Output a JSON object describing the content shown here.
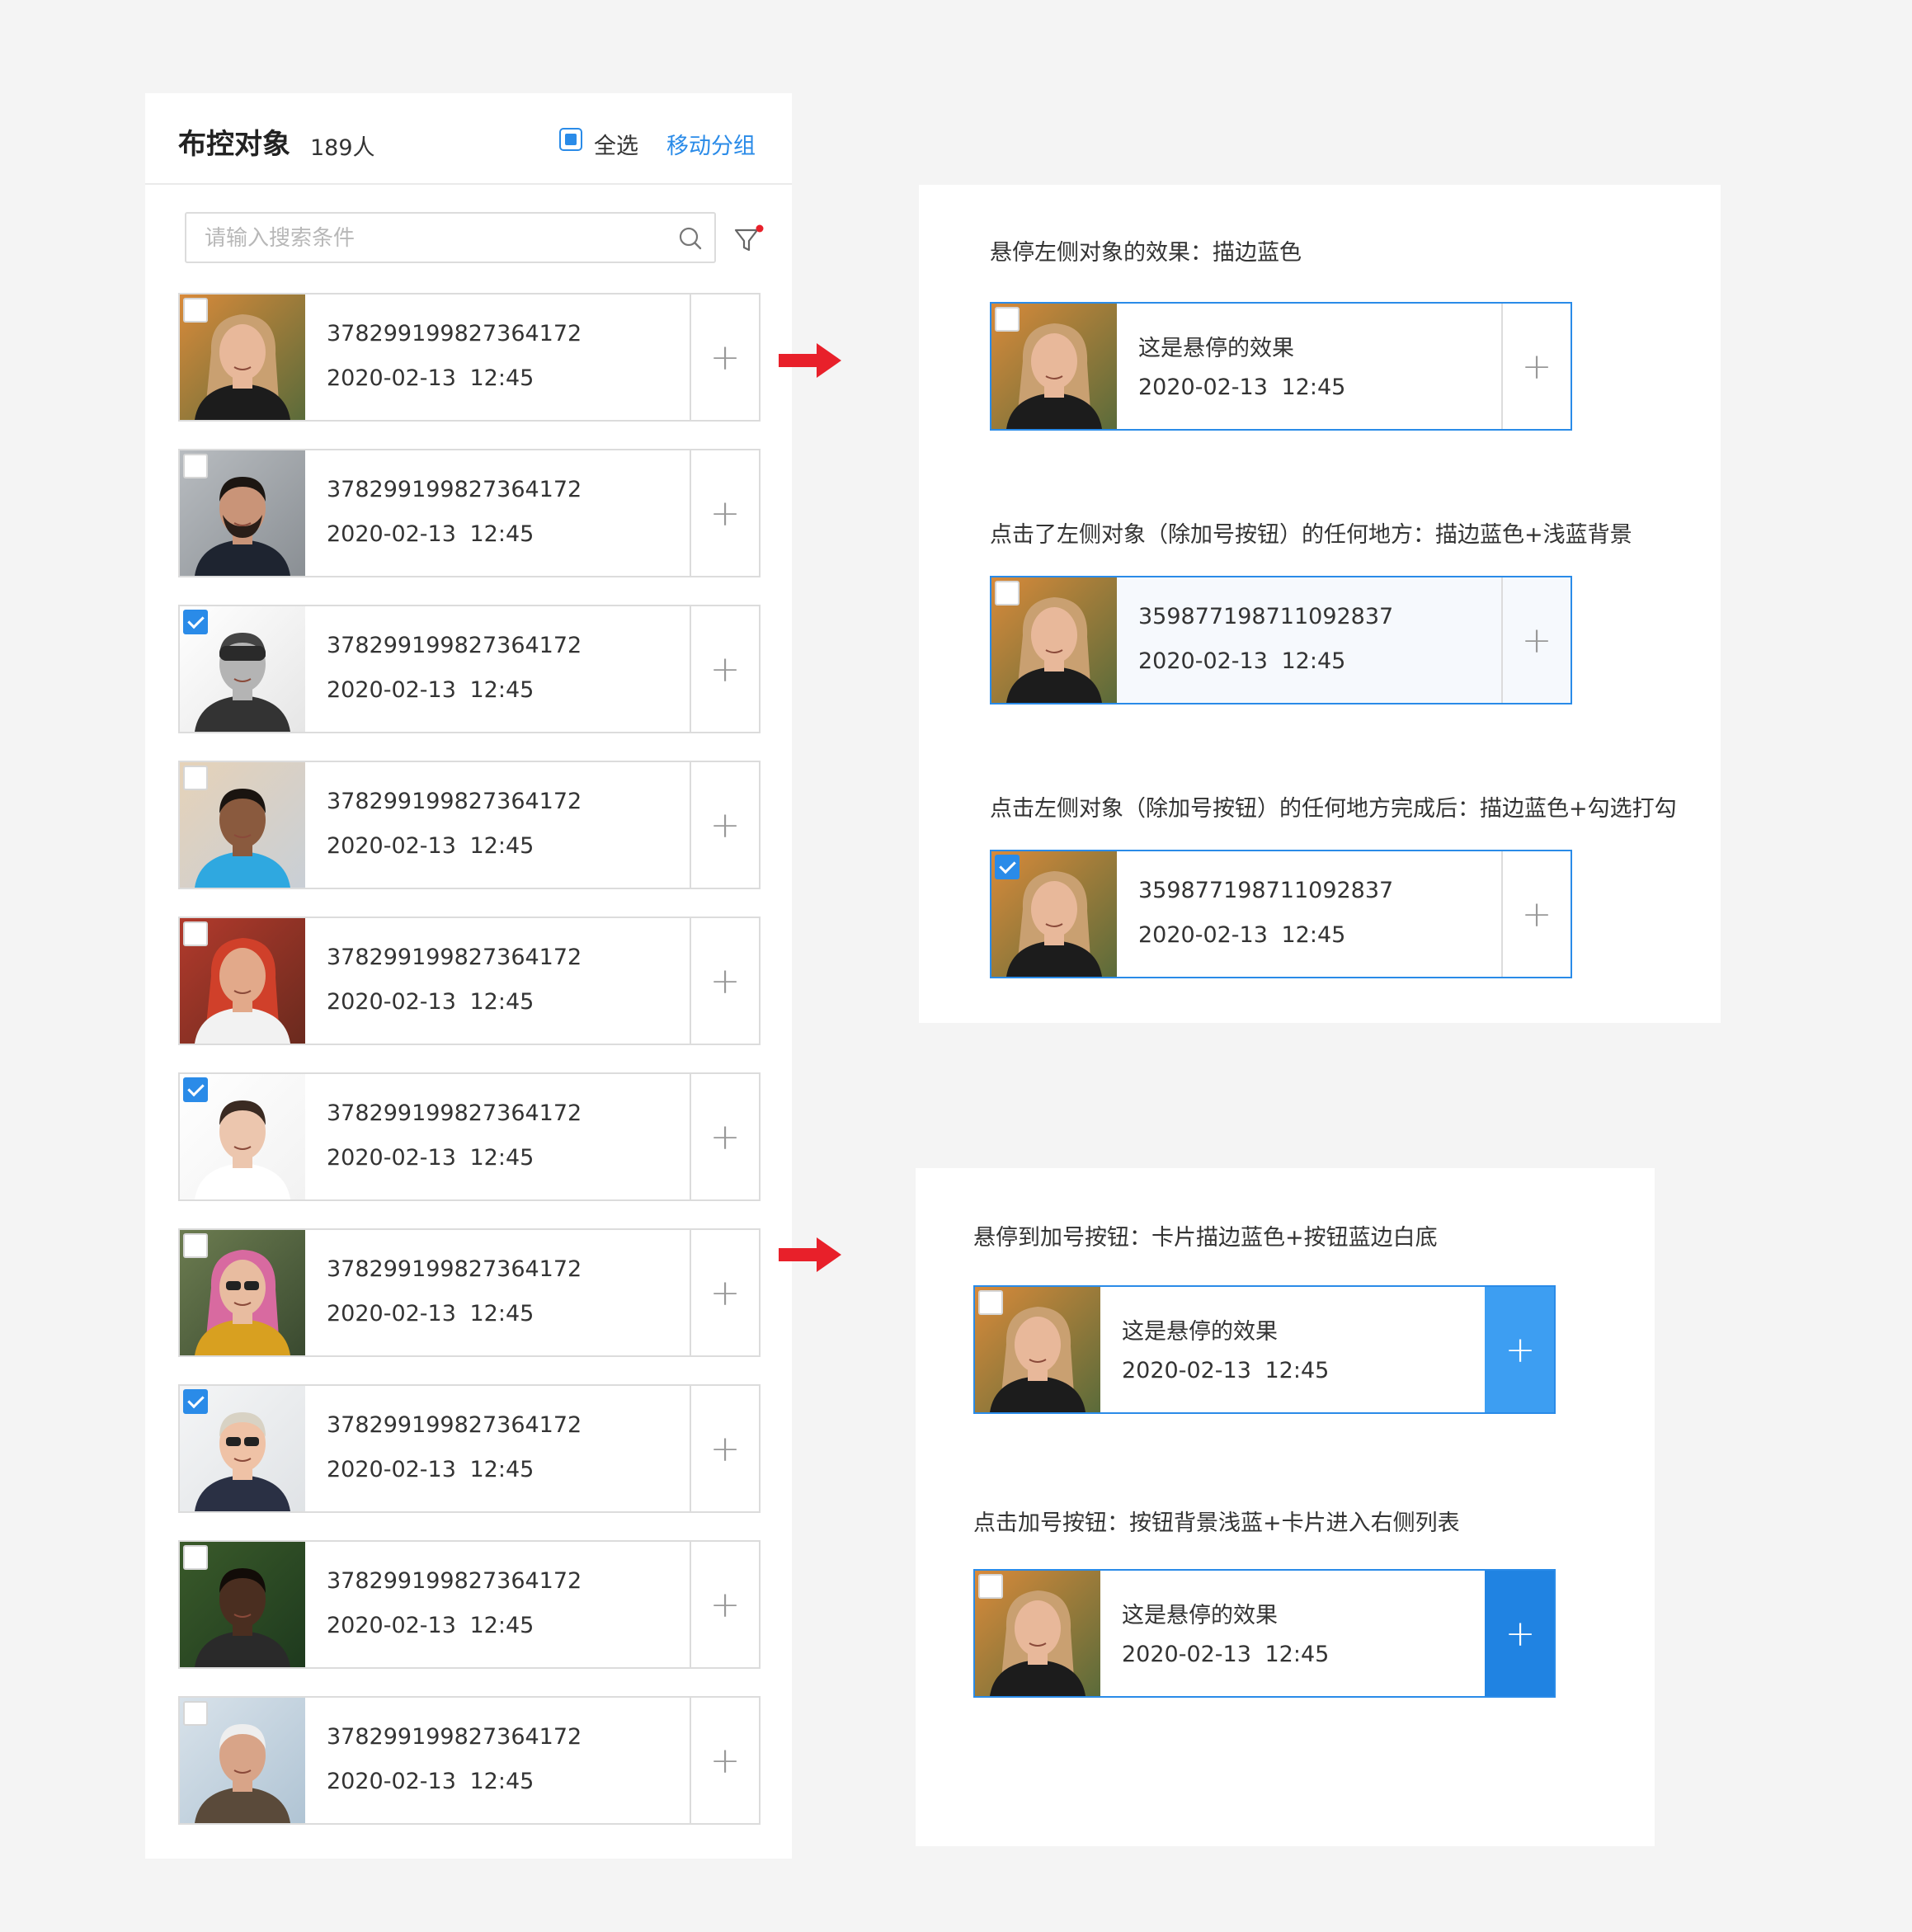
{
  "left_panel": {
    "title": "布控对象",
    "count": "189人",
    "select_all_label": "全选",
    "move_group_label": "移动分组",
    "search_placeholder": "请输入搜索条件",
    "plus": "+",
    "items": [
      {
        "id": "378299199827364172",
        "date": "2020-02-13 12:45",
        "checked": false,
        "photo": "woman-blonde"
      },
      {
        "id": "378299199827364172",
        "date": "2020-02-13 12:45",
        "checked": false,
        "photo": "man-beard"
      },
      {
        "id": "378299199827364172",
        "date": "2020-02-13 12:45",
        "checked": true,
        "photo": "woman-goggles-bw"
      },
      {
        "id": "378299199827364172",
        "date": "2020-02-13 12:45",
        "checked": false,
        "photo": "man-blue-shirt"
      },
      {
        "id": "378299199827364172",
        "date": "2020-02-13 12:45",
        "checked": false,
        "photo": "couple"
      },
      {
        "id": "378299199827364172",
        "date": "2020-02-13 12:45",
        "checked": true,
        "photo": "man-white-shirt"
      },
      {
        "id": "378299199827364172",
        "date": "2020-02-13 12:45",
        "checked": false,
        "photo": "woman-glasses-colorful"
      },
      {
        "id": "378299199827364172",
        "date": "2020-02-13 12:45",
        "checked": true,
        "photo": "man-sunglasses"
      },
      {
        "id": "378299199827364172",
        "date": "2020-02-13 12:45",
        "checked": false,
        "photo": "man-dark-skin"
      },
      {
        "id": "378299199827364172",
        "date": "2020-02-13 12:45",
        "checked": false,
        "photo": "old-man"
      }
    ]
  },
  "right_top": {
    "states": [
      {
        "note": "悬停左侧对象的效果：描边蓝色",
        "id": "这是悬停的效果",
        "date": "2020-02-13 12:45",
        "checked": false
      },
      {
        "note": "点击了左侧对象（除加号按钮）的任何地方：描边蓝色+浅蓝背景",
        "id": "359877198711092837",
        "date": "2020-02-13 12:45",
        "checked": false
      },
      {
        "note": "点击左侧对象（除加号按钮）的任何地方完成后：描边蓝色+勾选打勾",
        "id": "359877198711092837",
        "date": "2020-02-13 12:45",
        "checked": true
      }
    ]
  },
  "right_bottom": {
    "states": [
      {
        "note": "悬停到加号按钮：卡片描边蓝色+按钮蓝边白底",
        "id": "这是悬停的效果",
        "date": "2020-02-13 12:45"
      },
      {
        "note": "点击加号按钮：按钮背景浅蓝+卡片进入右侧列表",
        "id": "这是悬停的效果",
        "date": "2020-02-13 12:45"
      }
    ]
  },
  "colors": {
    "accent": "#2a8be8",
    "arrow": "#e8202a",
    "hover_plus": "#3d9ef2",
    "active_plus": "#2083e2"
  }
}
